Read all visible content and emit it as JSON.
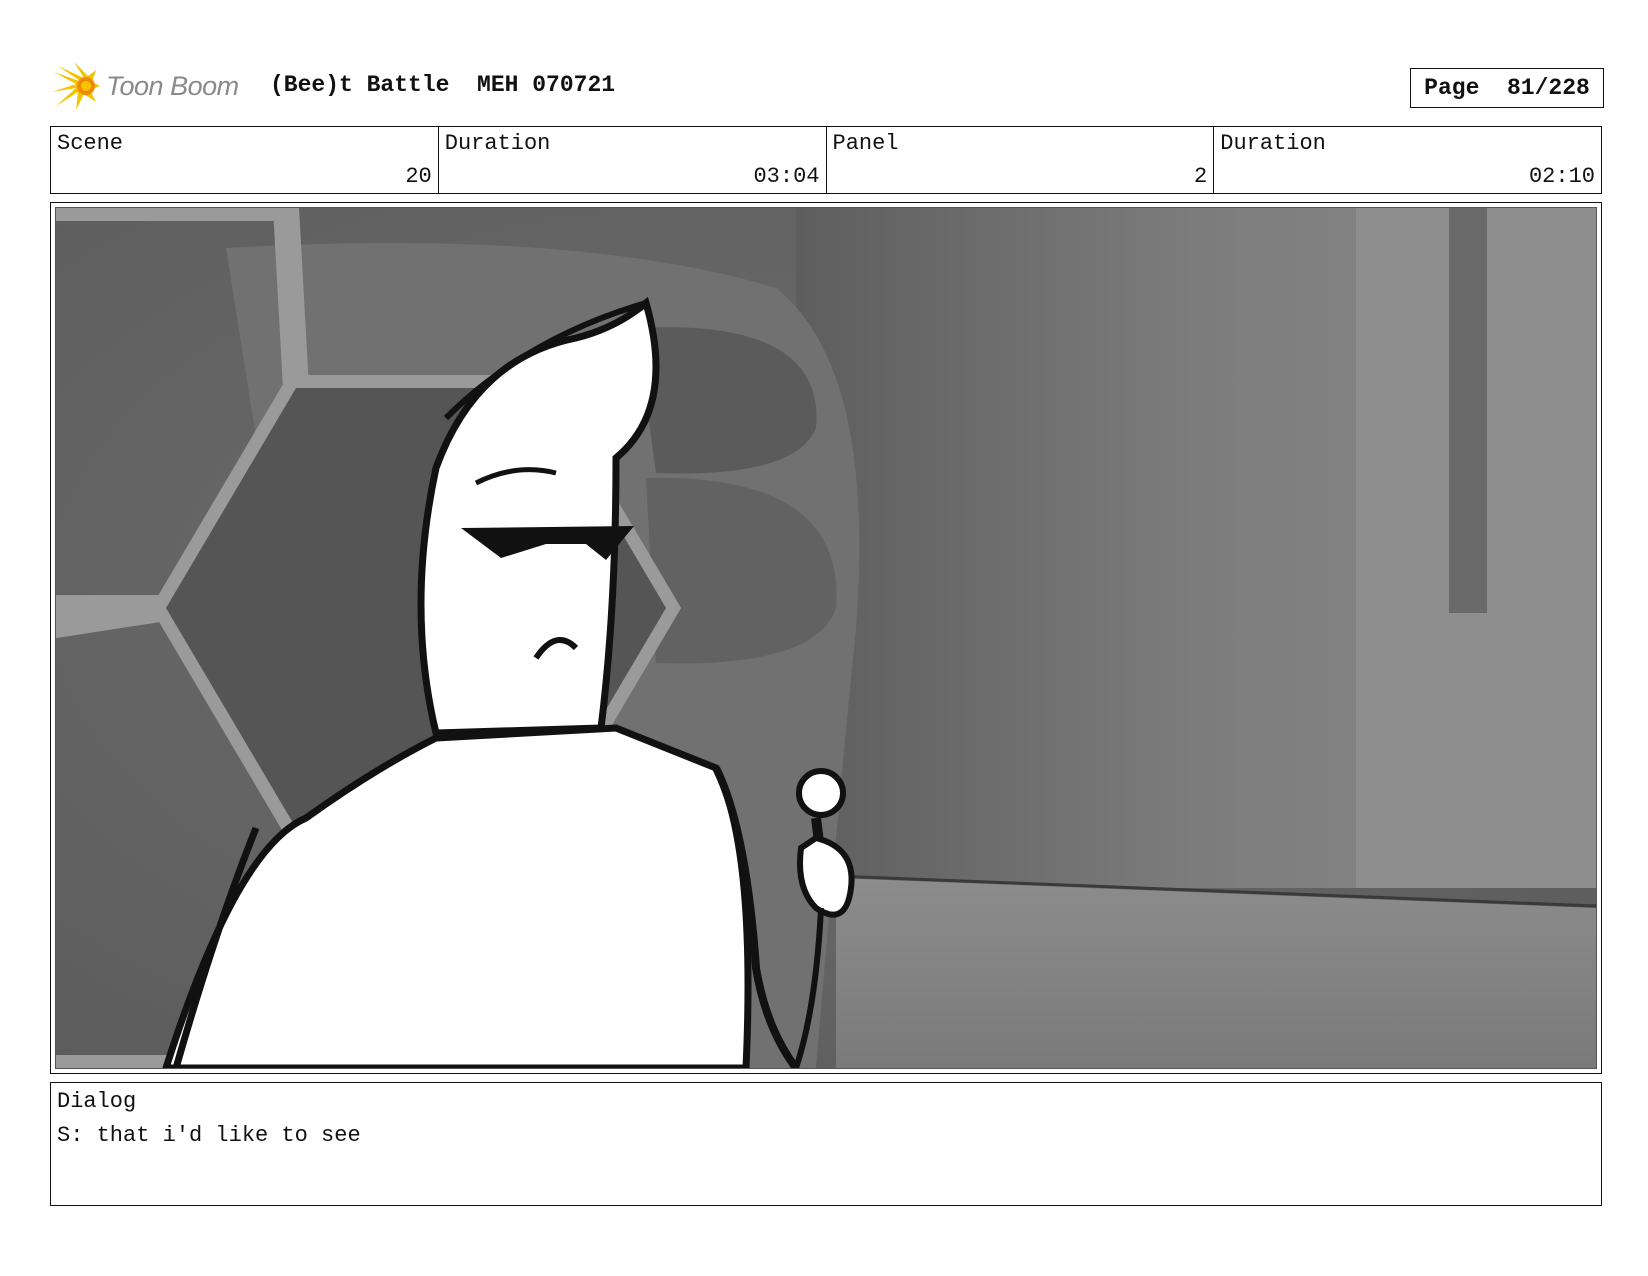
{
  "header": {
    "logo_text": "Toon Boom",
    "title": "(Bee)t Battle  MEH 070721",
    "page_label": "Page",
    "page_value": "81/228"
  },
  "info": {
    "scene_label": "Scene",
    "scene_value": "20",
    "scene_duration_label": "Duration",
    "scene_duration_value": "03:04",
    "panel_label": "Panel",
    "panel_value": "2",
    "panel_duration_label": "Duration",
    "panel_duration_value": "02:10"
  },
  "dialog": {
    "label": "Dialog",
    "text": "S: that i'd like to see"
  },
  "colors": {
    "logo_yellow": "#f5c400",
    "logo_orange": "#f08a00",
    "logo_text_gray": "#8a8a8a",
    "frame_black": "#111111"
  }
}
